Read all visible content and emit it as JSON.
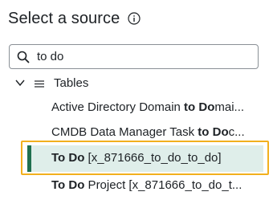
{
  "title": "Select a source",
  "search": {
    "value": "to do",
    "placeholder": ""
  },
  "tree": {
    "group_label": "Tables",
    "items": [
      {
        "bold": "",
        "pre": "Active Directory Domain ",
        "match": "to",
        "mid": " ",
        "match2": "Do",
        "post": "mai..."
      },
      {
        "pre": "CMDB Data Manager Task ",
        "match": "to",
        "mid": " ",
        "match2": "Do",
        "post": "c..."
      },
      {
        "match": "To",
        "mid": " ",
        "match2": "Do",
        "post": " [x_871666_to_do_to_do]"
      },
      {
        "match": "To",
        "mid": " ",
        "match2": "Do",
        "post": " Project [x_871666_to_do_t..."
      }
    ]
  },
  "colors": {
    "selection_bg": "#dfeeea",
    "selection_bar": "#20704f",
    "focus_outline": "#f2b01e"
  }
}
